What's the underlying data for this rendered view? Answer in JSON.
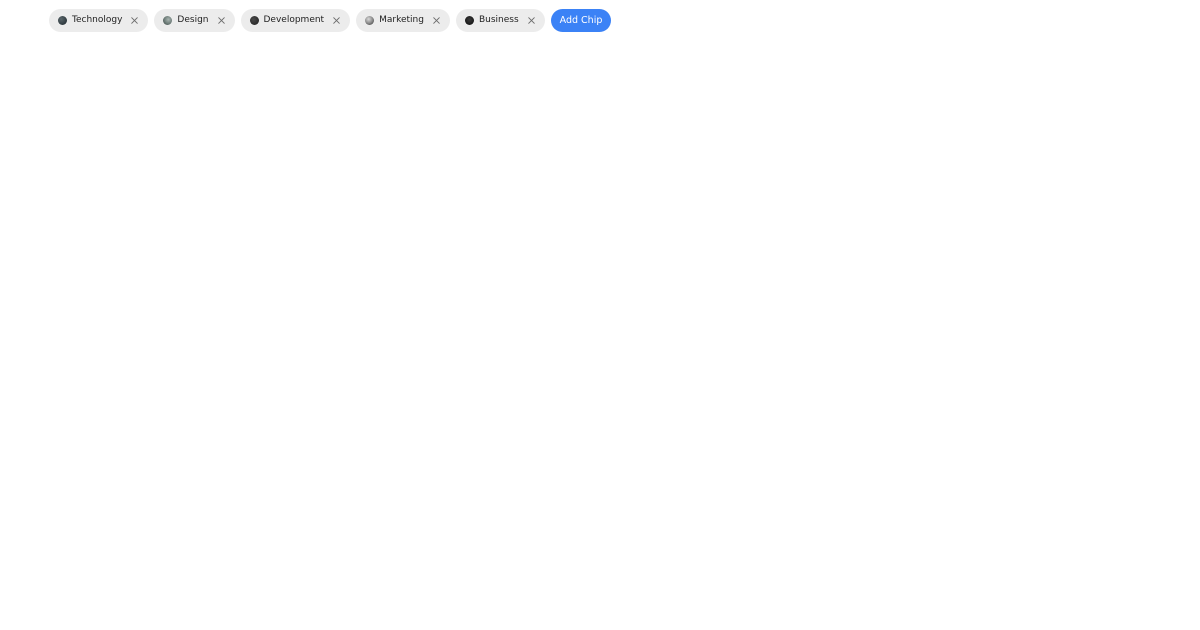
{
  "chips": [
    {
      "label": "Technology",
      "avatar_icon": "technology-avatar-icon",
      "avatar_color": "#2f3a3f",
      "remove_icon": "close-icon"
    },
    {
      "label": "Design",
      "avatar_icon": "design-avatar-icon",
      "avatar_color": "#6b7a76",
      "remove_icon": "close-icon"
    },
    {
      "label": "Development",
      "avatar_icon": "development-avatar-icon",
      "avatar_color": "#2b2b2b",
      "remove_icon": "close-icon"
    },
    {
      "label": "Marketing",
      "avatar_icon": "marketing-avatar-icon",
      "avatar_color": "#8c8c8c",
      "remove_icon": "close-icon"
    },
    {
      "label": "Business",
      "avatar_icon": "business-avatar-icon",
      "avatar_color": "#1c1c1c",
      "remove_icon": "close-icon"
    }
  ],
  "add_chip": {
    "label": "Add Chip"
  },
  "colors": {
    "chip_background": "#ececec",
    "chip_text": "#1f1f1f",
    "close_icon": "#6b6b6b",
    "accent": "#3b82f6",
    "page_background": "#ffffff"
  }
}
